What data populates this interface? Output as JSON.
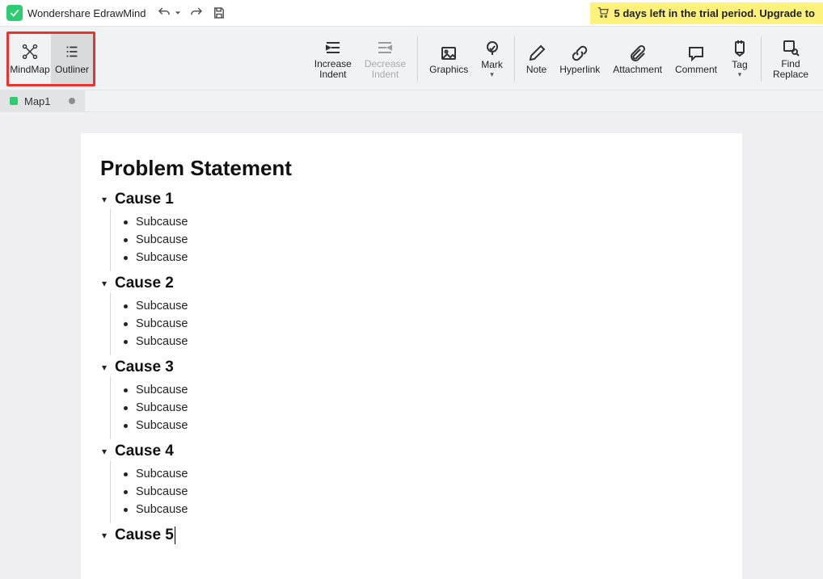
{
  "app": {
    "title": "Wondershare EdrawMind"
  },
  "trial": {
    "text": "5 days left in the trial period. Upgrade to"
  },
  "view_toggle": {
    "mindmap": "MindMap",
    "outliner": "Outliner"
  },
  "ribbon": {
    "increase_indent": "Increase\nIndent",
    "decrease_indent": "Decrease\nIndent",
    "graphics": "Graphics",
    "mark": "Mark",
    "note": "Note",
    "hyperlink": "Hyperlink",
    "attachment": "Attachment",
    "comment": "Comment",
    "tag": "Tag",
    "find_replace": "Find\nReplace"
  },
  "tab": {
    "name": "Map1"
  },
  "outline": {
    "title": "Problem Statement",
    "causes": [
      {
        "title": "Cause 1",
        "subs": [
          "Subcause",
          "Subcause",
          "Subcause"
        ]
      },
      {
        "title": "Cause 2",
        "subs": [
          "Subcause",
          "Subcause",
          "Subcause"
        ]
      },
      {
        "title": "Cause 3",
        "subs": [
          "Subcause",
          "Subcause",
          "Subcause"
        ]
      },
      {
        "title": "Cause 4",
        "subs": [
          "Subcause",
          "Subcause",
          "Subcause"
        ]
      },
      {
        "title": "Cause 5",
        "subs": []
      }
    ]
  }
}
